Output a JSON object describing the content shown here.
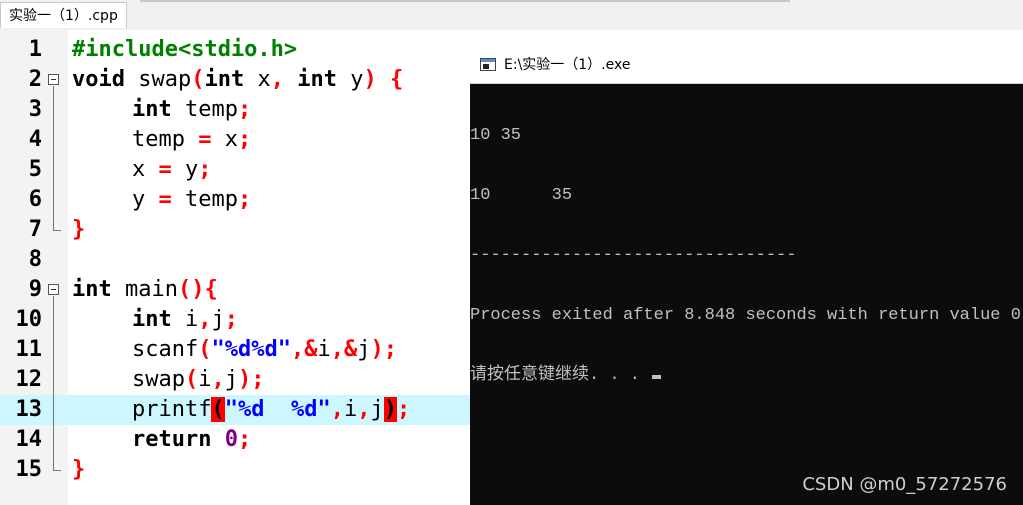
{
  "tab": {
    "label": "实验一（1）.cpp"
  },
  "editor": {
    "line_numbers": [
      "1",
      "2",
      "3",
      "4",
      "5",
      "6",
      "7",
      "8",
      "9",
      "10",
      "11",
      "12",
      "13",
      "14",
      "15"
    ]
  },
  "code": {
    "l1": "#include<stdio.h>",
    "l2": {
      "kw1": "void",
      "fn": " swap",
      "p1": "(",
      "kw2": "int",
      "a": " x",
      "p2": ",",
      "kw3": " int",
      "b": " y",
      "p3": ") {"
    },
    "l3": {
      "kw": "int",
      "v": " temp",
      "p": ";"
    },
    "l4": {
      "a": "temp ",
      "op": "=",
      "b": " x",
      "p": ";"
    },
    "l5": {
      "a": "x ",
      "op": "=",
      "b": " y",
      "p": ";"
    },
    "l6": {
      "a": "y ",
      "op": "=",
      "b": " temp",
      "p": ";"
    },
    "l7": "}",
    "l9": {
      "kw": "int",
      "fn": " main",
      "p": "(){"
    },
    "l10": {
      "kw": "int",
      "v": " i",
      "c": ",",
      "w": "j",
      "p": ";"
    },
    "l11": {
      "fn": "scanf",
      "p1": "(",
      "s": "\"%d%d\"",
      "c1": ",",
      "o1": "&",
      "a": "i",
      "c2": ",",
      "o2": "&",
      "b": "j",
      "p2": ");"
    },
    "l12": {
      "fn": "swap",
      "p1": "(",
      "a": "i",
      "c": ",",
      "b": "j",
      "p2": ");"
    },
    "l13": {
      "fn": "printf",
      "p1": "(",
      "s": "\"%d  %d\"",
      "c1": ",",
      "a": "i",
      "c2": ",",
      "b": "j",
      "p2": ")",
      "p3": ";"
    },
    "l14": {
      "kw": "return",
      "n": " 0",
      "p": ";"
    },
    "l15": "}"
  },
  "console": {
    "title": "E:\\实验一（1）.exe",
    "lines": [
      "10 35",
      "10      35",
      "--------------------------------",
      "Process exited after 8.848 seconds with return value 0",
      "请按任意键继续. . . "
    ]
  },
  "watermark": "CSDN @m0_57272576"
}
